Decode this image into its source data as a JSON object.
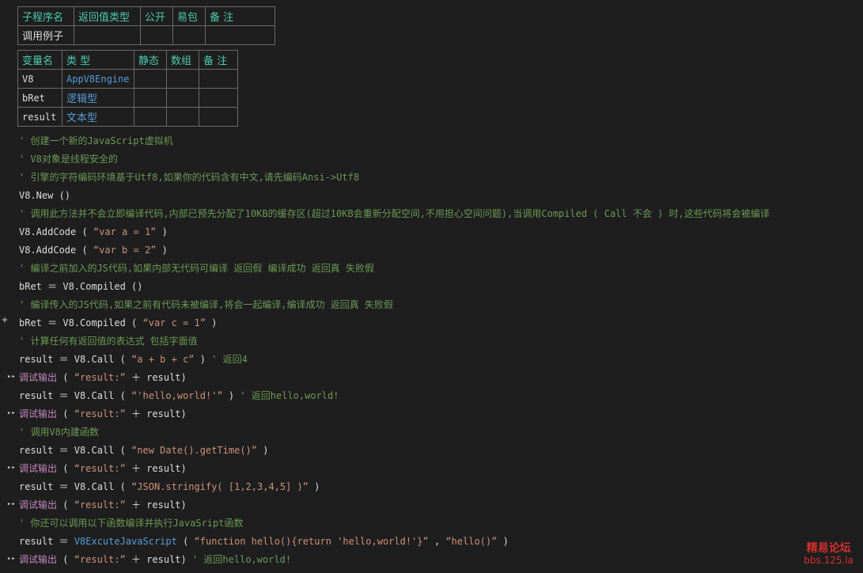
{
  "proc_table": {
    "headers": [
      "子程序名",
      "返回值类型",
      "公开",
      "易包",
      "备 注"
    ],
    "row": [
      "调用例子",
      "",
      "",
      "",
      ""
    ]
  },
  "var_table": {
    "headers": [
      "变量名",
      "类 型",
      "静态",
      "数组",
      "备 注"
    ],
    "rows": [
      {
        "name": "V8",
        "type": "AppV8Engine"
      },
      {
        "name": "bRet",
        "type": "逻辑型"
      },
      {
        "name": "result",
        "type": "文本型"
      }
    ]
  },
  "code": {
    "c1": "' 创建一个新的JavaScript虚拟机",
    "c2": "' V8对象是线程安全的",
    "c3": "' 引擎的字符编码环境基于Utf8,如果你的代码含有中文,请先编码Ansi->Utf8",
    "l_new": "V8.New ()",
    "c4": "' 调用此方法并不会立即编译代码,内部已预先分配了10KB的缓存区(超过10KB会重新分配空间,不用担心空间问题),当调用Compiled ( Call 不会 ) 时,这些代码将会被编译",
    "add1_pre": "V8.AddCode ( ",
    "add1_str": "“var a = 1”",
    "add_post": " )",
    "add2_str": "“var b = 2”",
    "c5": "' 编译之前加入的JS代码,如果内部无代码可编译 返回假 编译成功 返回真 失败假",
    "l_compiled1": "bRet ＝ V8.Compiled ()",
    "c6": "' 编译传入的JS代码,如果之前有代码未被编译,将会一起编译,编译成功 返回真 失败假",
    "compiled2_pre": "bRet ＝ V8.Compiled ( ",
    "compiled2_str": "“var c = 1”",
    "c7": "' 计算任何有返回值的表达式 包括字面值",
    "call_pre": "result ＝ V8.Call ( ",
    "call1_str": "“a + b + c”",
    "call1_post": " )  ",
    "call1_cmt": "' 返回4",
    "debug_label": "调试输出",
    "debug_mid": " ( ",
    "debug_str": "“result:”",
    "debug_post": "  ＋ result)",
    "call2_str": "“'hello,world!'”",
    "call2_post": " )  ",
    "call2_cmt": "' 返回hello,world!",
    "c8": "' 调用V8内建函数",
    "call3_str": "“new Date().getTime()”",
    "call4_str": "“JSON.stringify( [1,2,3,4,5] )”",
    "c9": "' 你还可以调用以下函数编译并执行JavaSript函数",
    "exec_pre": "result ＝ ",
    "exec_fn": "V8ExcuteJavaScript",
    "exec_mid": " ( ",
    "exec_str1": "“function hello(){return 'hello,world!'}”",
    "exec_sep": " ,  ",
    "exec_str2": "“hello()”",
    "last_debug_post": "  ＋ result)  ",
    "last_cmt": "' 返回hello,world!"
  },
  "watermark": {
    "title": "精易论坛",
    "url": "bbs.125.la"
  }
}
